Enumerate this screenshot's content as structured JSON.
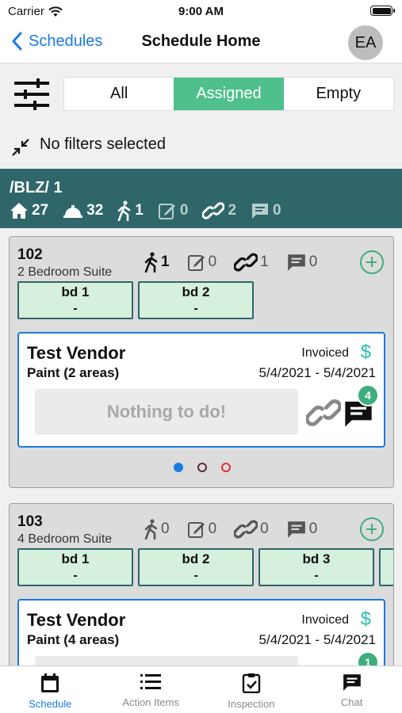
{
  "status": {
    "carrier": "Carrier",
    "time": "9:00 AM"
  },
  "nav": {
    "back_label": "Schedules",
    "title": "Schedule Home",
    "avatar_initials": "EA"
  },
  "segments": [
    {
      "label": "All",
      "active": false
    },
    {
      "label": "Assigned",
      "active": true
    },
    {
      "label": "Empty",
      "active": false
    }
  ],
  "filters_text": "No filters selected",
  "group": {
    "title": "/BLZ/ 1",
    "homes": "27",
    "services": "32",
    "walks": "1",
    "notes": "0",
    "links": "2",
    "messages": "0"
  },
  "units": [
    {
      "number": "102",
      "type": "2 Bedroom Suite",
      "walks": "1",
      "notes": "0",
      "links": "1",
      "messages": "0",
      "rooms": [
        {
          "name": "bd 1",
          "value": "-"
        },
        {
          "name": "bd 2",
          "value": "-"
        }
      ],
      "vendor": {
        "name": "Test Vendor",
        "task": "Paint (2 areas)",
        "status": "Invoiced",
        "dollar": "$",
        "dates": "5/4/2021 - 5/4/2021",
        "empty_message": "Nothing to do!",
        "chat_count": "4"
      },
      "pager_colors": [
        "#1a7ae0",
        "#5a2a3a",
        "#e03030"
      ]
    },
    {
      "number": "103",
      "type": "4 Bedroom Suite",
      "walks": "0",
      "notes": "0",
      "links": "0",
      "messages": "0",
      "rooms": [
        {
          "name": "bd 1",
          "value": "-"
        },
        {
          "name": "bd 2",
          "value": "-"
        },
        {
          "name": "bd 3",
          "value": "-"
        }
      ],
      "vendor": {
        "name": "Test Vendor",
        "task": "Paint (4 areas)",
        "status": "Invoiced",
        "dollar": "$",
        "dates": "5/4/2021 - 5/4/2021",
        "chat_count": "1"
      }
    }
  ],
  "tabs": [
    {
      "label": "Schedule",
      "icon": "calendar-icon",
      "active": true
    },
    {
      "label": "Action Items",
      "icon": "list-icon",
      "active": false
    },
    {
      "label": "Inspection",
      "icon": "clipboard-check-icon",
      "active": false
    },
    {
      "label": "Chat",
      "icon": "chat-icon",
      "active": false
    }
  ]
}
